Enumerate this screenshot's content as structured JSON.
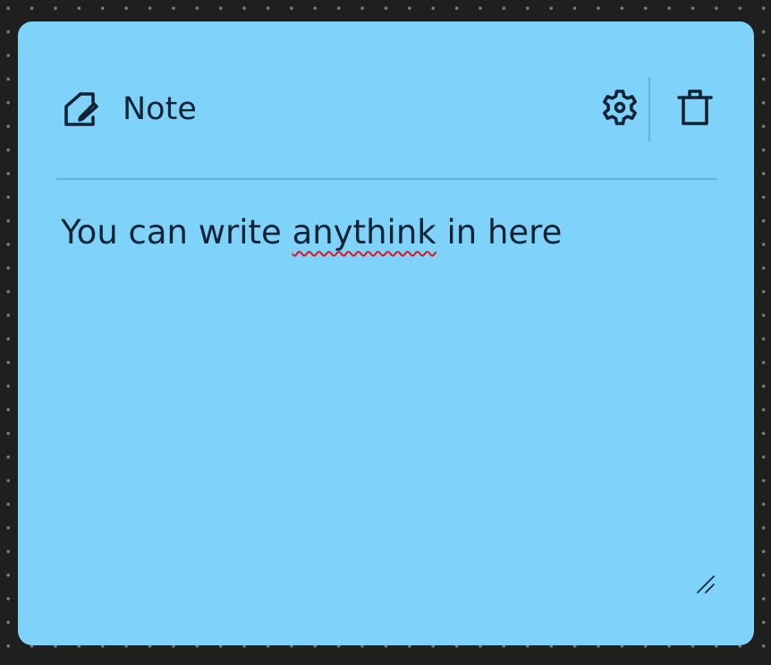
{
  "note": {
    "title": "Note",
    "body_before": "You can write ",
    "body_misspelled": "anythink",
    "body_after": " in here",
    "background_color": "#7fd3fb",
    "text_color": "#132235"
  },
  "toolbar": {
    "icons": [
      "note-edit-icon",
      "gear-icon",
      "trash-icon",
      "resize-handle-icon"
    ]
  },
  "canvas": {
    "background_color": "#1f1f1f",
    "grid": "dots"
  }
}
